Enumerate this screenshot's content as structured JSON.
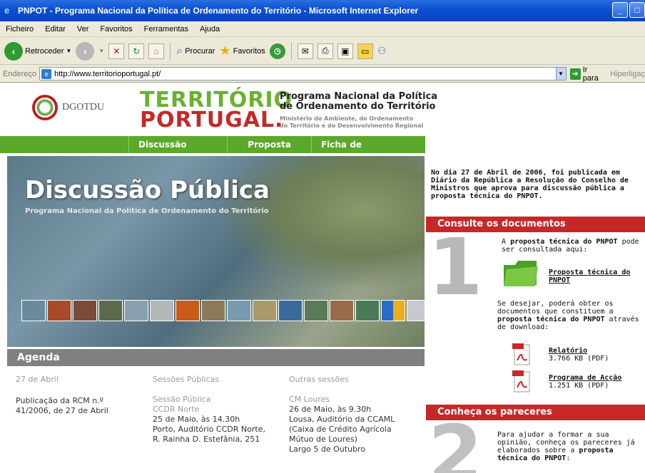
{
  "window": {
    "title": "PNPOT - Programa Nacional da Política de Ordenamento do Território - Microsoft Internet Explorer",
    "min": "_",
    "close": "□"
  },
  "menu": [
    "Ficheiro",
    "Editar",
    "Ver",
    "Favoritos",
    "Ferramentas",
    "Ajuda"
  ],
  "toolbar": {
    "back": "Retroceder",
    "search": "Procurar",
    "favorites": "Favoritos"
  },
  "address": {
    "label": "Endereço",
    "url": "http://www.territorioportugal.pt/",
    "go": "Ir para",
    "links": "Hiperligaç"
  },
  "header": {
    "dgotdu": "DGOTDU",
    "title_line1": "TERRITÓRIO",
    "title_line2": "PORTUGAL.",
    "pnpot_line1": "Programa Nacional da Política",
    "pnpot_line2": "de Ordenamento do Território",
    "ministry_line1": "Ministério do Ambiente, do Ordenamento",
    "ministry_line2": "do Território e do Desenvolvimento Regional"
  },
  "nav": [
    "Discussão Pública",
    "Proposta",
    "Ficha de Participação"
  ],
  "hero": {
    "title": "Discussão Pública",
    "subtitle": "Programa Nacional da Política de Ordenamento do Território"
  },
  "agenda": {
    "title": "Agenda",
    "col1": {
      "head": "27 de Abril",
      "l1": "Publicação da RCM n.º",
      "l2": "41/2006, de 27 de Abril"
    },
    "col2": {
      "head": "Sessões Públicas",
      "t1": "Sessão Pública",
      "t2": "CCDR Norte",
      "l1": "25 de Maio, às 14.30h",
      "l2": "Porto, Auditório CCDR Norte,",
      "l3": "R. Rainha D. Estefânia, 251"
    },
    "col3": {
      "head": "Outras sessões",
      "t1": "CM Loures",
      "l1": "26 de Maio, às 9.30h",
      "l2": "Lousa, Auditório da CCAML",
      "l3": "(Caixa de Crédito Agrícola",
      "l4": "Mútuo de Loures)",
      "l5": "Largo 5 de Outubro"
    }
  },
  "sidebar": {
    "intro": "No dia 27 de Abril de 2006, foi publicada em Diário da República a Resolução do Conselho de Ministros que aprova para discussão pública a proposta técnica do PNPOT.",
    "section1": "Consulte os documentos",
    "num1": "1",
    "s1_a": "A",
    "s1_b": "proposta técnica do PNPOT",
    "s1_c": "pode ser consultada aqui:",
    "doc_link": "Proposta técnica do PNPOT",
    "s1_d": "Se desejar, poderá obter os documentos que constituem a",
    "s1_e": "proposta técnica do PNPOT",
    "s1_f": "através de download:",
    "rel_label": "Relatório",
    "rel_size": "3.766 KB (PDF)",
    "prog_label": "Programa de Acção",
    "prog_size": "1.251 KB (PDF)",
    "section2": "Conheça os pareceres",
    "num2": "2",
    "s2_a": "Para ajudar a formar a sua opinião, conheça os pareceres já elaborados sobre a",
    "s2_b": "proposta técnica do PNPOT",
    "s2_c": ":"
  }
}
